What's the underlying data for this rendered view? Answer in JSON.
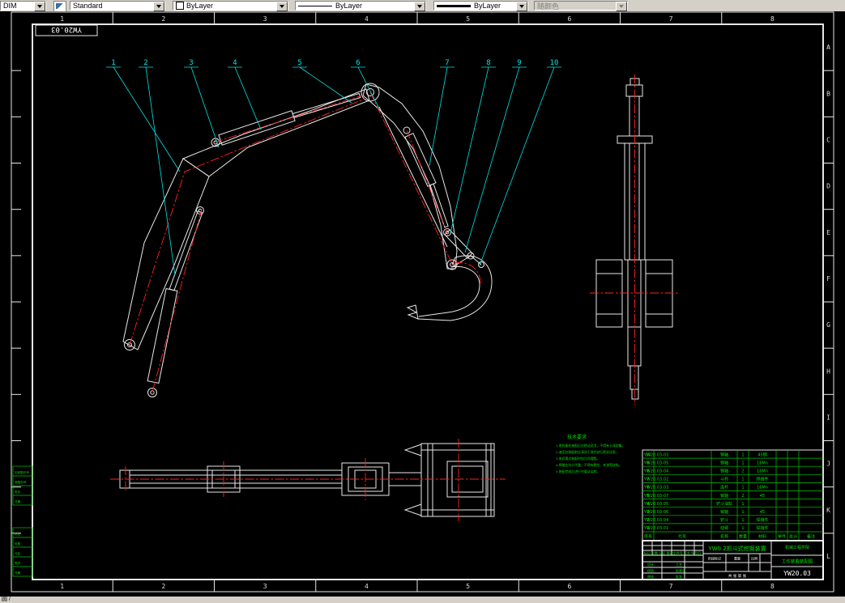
{
  "toolbar": {
    "dim": "DIM",
    "text_style": "Standard",
    "color": "ByLayer",
    "linetype": "ByLayer",
    "lineweight": "ByLayer",
    "plot_style": "随颜色"
  },
  "statusbar": {
    "left": "圆 /"
  },
  "frame": {
    "label": "YW20.03",
    "top_zones": [
      "1",
      "2",
      "3",
      "4",
      "5",
      "6",
      "7",
      "8"
    ],
    "bottom_zones": [
      "1",
      "2",
      "3",
      "4",
      "5",
      "6",
      "7",
      "8"
    ],
    "right_rows": [
      "A",
      "B",
      "C",
      "D",
      "E",
      "F",
      "G",
      "H",
      "I",
      "J",
      "K",
      "L"
    ]
  },
  "drawing": {
    "balloons": [
      "1",
      "2",
      "3",
      "4",
      "5",
      "6",
      "7",
      "8",
      "9",
      "10"
    ],
    "notes": {
      "title": "技术要求",
      "lines": [
        "1.各铰接处装配后应转动灵活，不得有卡滞现象。",
        "2.液压缸装配前应清洗干净并进行密封试验。",
        "3.各润滑点装配时加注润滑脂。",
        "4.焊缝应均匀平整，不得有裂纹、夹渣等缺陷。",
        "5.装配完成后进行空载试运转。"
      ]
    },
    "margin_table_top": [
      "旧底图总号",
      "底图总号",
      "签字",
      "日期"
    ],
    "margin_table_bottom": [
      "标记",
      "处数",
      "分区",
      "签字",
      "日期"
    ]
  },
  "bom": {
    "header": [
      "序号",
      "代号",
      "名称",
      "数量",
      "材料",
      "单件",
      "总计",
      "备注"
    ],
    "rows": [
      {
        "no": "10",
        "code": "YW20.03-03",
        "name": "销轴",
        "qty": "1",
        "mat": "45钢",
        "rem": ""
      },
      {
        "no": "9",
        "code": "YW20.03-05",
        "name": "销轴",
        "qty": "1",
        "mat": "16Mn",
        "rem": ""
      },
      {
        "no": "8",
        "code": "YW20.03-04",
        "name": "销轴",
        "qty": "2",
        "mat": "16Mn",
        "rem": ""
      },
      {
        "no": "7",
        "code": "YW20.03.02",
        "name": "斗杆",
        "qty": "1",
        "mat": "焊接件",
        "rem": ""
      },
      {
        "no": "6",
        "code": "YW20.03.03",
        "name": "连杆",
        "qty": "1",
        "mat": "16Mn",
        "rem": ""
      },
      {
        "no": "5",
        "code": "YW20.03-07",
        "name": "销轴",
        "qty": "2",
        "mat": "45",
        "rem": ""
      },
      {
        "no": "4",
        "code": "YW20.03.05",
        "name": "铲斗油缸",
        "qty": "1",
        "mat": "",
        "rem": ""
      },
      {
        "no": "3",
        "code": "YW20.03-06",
        "name": "销轴",
        "qty": "1",
        "mat": "45",
        "rem": ""
      },
      {
        "no": "2",
        "code": "YW20.03.04",
        "name": "铲斗",
        "qty": "1",
        "mat": "焊接件",
        "rem": ""
      },
      {
        "no": "1",
        "code": "YW20.03.01",
        "name": "动臂",
        "qty": "1",
        "mat": "焊接件",
        "rem": ""
      }
    ]
  },
  "titleblock": {
    "product": "YW0.2抓斗式挖掘装置",
    "org": "机械工程学院",
    "drawing_name": "工作装置装配图",
    "number": "YW20.03",
    "stage_label": "阶段标记",
    "weight_label": "重量",
    "scale_label": "比例",
    "sheet_label": "共 张 第 张",
    "rev_header": "标记 处数 分区 更改文件号 签名 年月日",
    "sign_rows": [
      "设计",
      "校核",
      "审核",
      "工艺",
      "标准化",
      "批准"
    ]
  }
}
